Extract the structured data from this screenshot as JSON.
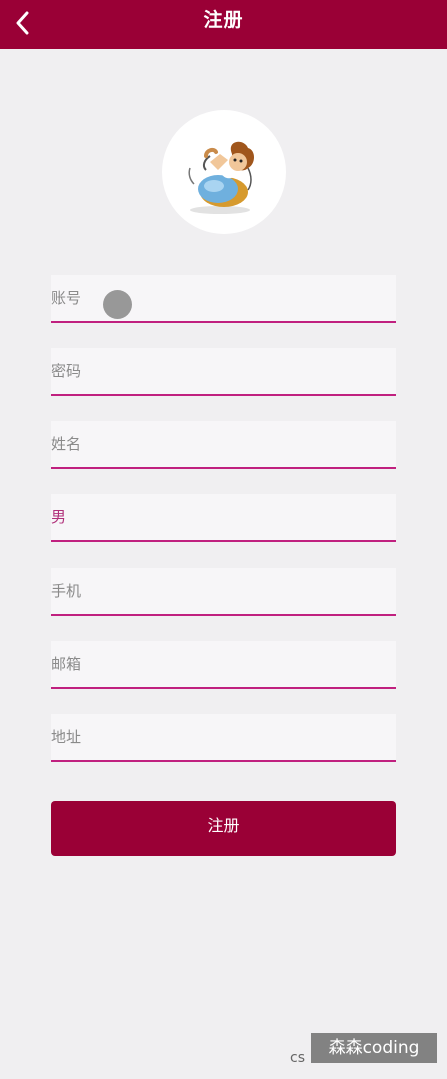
{
  "header": {
    "title": "注册",
    "back_icon": "chevron-left-icon"
  },
  "form": {
    "account_placeholder": "账号",
    "password_placeholder": "密码",
    "name_placeholder": "姓名",
    "gender_placeholder": "男",
    "phone_placeholder": "手机",
    "email_placeholder": "邮箱",
    "address_placeholder": "地址"
  },
  "submit_label": "注册",
  "watermark": {
    "prefix": "cs",
    "text": "森森coding"
  },
  "colors": {
    "header_bg": "#9a0036",
    "underline": "#c0207f",
    "page_bg": "#f0eff1",
    "button_bg": "#9a0036"
  }
}
